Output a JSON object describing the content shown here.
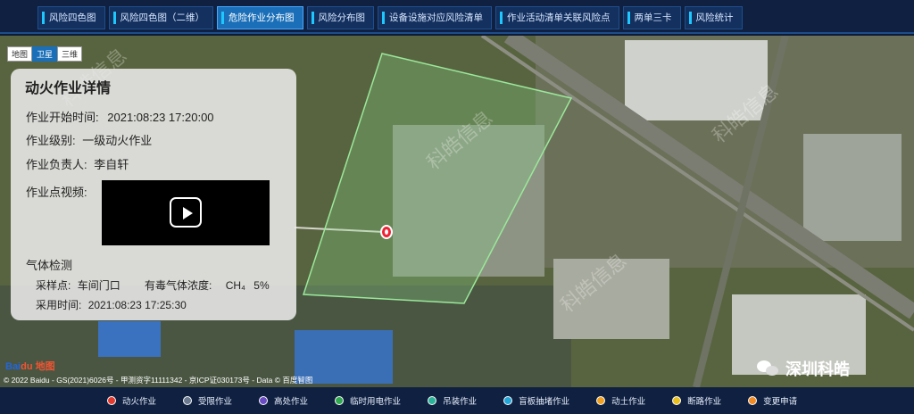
{
  "nav": {
    "tabs": [
      {
        "label": "风险四色图",
        "active": false
      },
      {
        "label": "风险四色图（二维）",
        "active": false
      },
      {
        "label": "危险作业分布图",
        "active": true
      },
      {
        "label": "风险分布图",
        "active": false
      },
      {
        "label": "设备设施对应风险清单",
        "active": false
      },
      {
        "label": "作业活动清单关联风险点",
        "active": false
      },
      {
        "label": "两单三卡",
        "active": false
      },
      {
        "label": "风险统计",
        "active": false
      }
    ]
  },
  "map": {
    "types": [
      "地图",
      "卫星",
      "三维"
    ],
    "selected_type": "卫星",
    "watermark_text": "科皓信息",
    "baidu_logo": "Bai",
    "baidu_logo_cn": "du 地图",
    "copyright": "© 2022 Baidu - GS(2021)6026号 - 甲测资字11111342 - 京ICP证030173号 - Data © 百度智图"
  },
  "detail": {
    "title": "动火作业详情",
    "start_time_label": "作业开始时间:",
    "start_time": "2021:08:23  17:20:00",
    "level_label": "作业级别:",
    "level": "一级动火作业",
    "owner_label": "作业负责人:",
    "owner": "李自轩",
    "video_label": "作业点视频:",
    "gas": {
      "title": "气体检测",
      "point_label": "采样点:",
      "point": "车间门口",
      "toxic_label": "有毒气体浓度:",
      "toxic_gas": "CH₄",
      "toxic_value": "5%",
      "time_label": "采用时间:",
      "time": "2021:08:23  17:25:30"
    }
  },
  "brand": {
    "name": "深圳科皓"
  },
  "legend": [
    {
      "label": "动火作业",
      "color": "#e23a2e"
    },
    {
      "label": "受限作业",
      "color": "#6b7a8f"
    },
    {
      "label": "高处作业",
      "color": "#6a4bc4"
    },
    {
      "label": "临时用电作业",
      "color": "#2fa84f"
    },
    {
      "label": "吊装作业",
      "color": "#2bb39a"
    },
    {
      "label": "盲板抽堵作业",
      "color": "#22a6d8"
    },
    {
      "label": "动土作业",
      "color": "#f0a020"
    },
    {
      "label": "断路作业",
      "color": "#e8c020"
    },
    {
      "label": "变更申请",
      "color": "#f08a24"
    }
  ]
}
